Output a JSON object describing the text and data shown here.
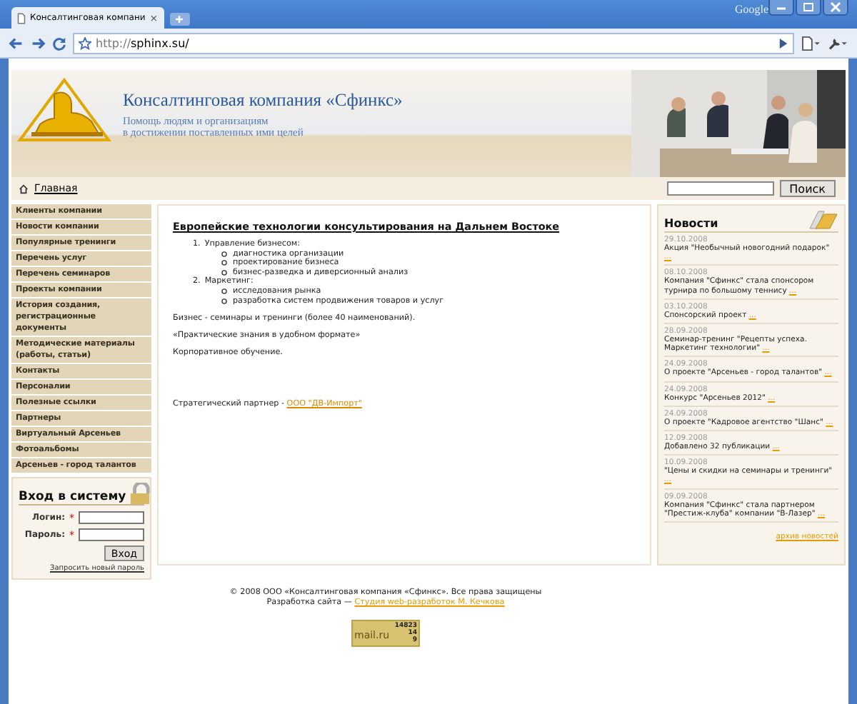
{
  "browser": {
    "brand": "Google",
    "tab_title": "Консалтинговая компани",
    "tab_close": "×",
    "url_prefix": "http://",
    "url_rest": "sphinx.su/"
  },
  "header": {
    "title": "Консалтинговая компания «Сфинкс»",
    "slogan": [
      "Помощь людям и организациям",
      "в достижении поставленных ими целей"
    ]
  },
  "breadcrumb": "Главная",
  "search": {
    "button": "Поиск"
  },
  "nav": [
    "Клиенты компании",
    "Новости компании",
    "Популярные тренинги",
    "Перечень услуг",
    "Перечень семинаров",
    "Проекты компании",
    "История создания, регистрационные документы",
    "Методические материалы (работы, статьи)",
    "Контакты",
    "Персоналии",
    "Полезные ссылки",
    "Партнеры",
    "Виртуальный Арсеньев",
    "Фотоальбомы",
    "Арсеньев - город талантов"
  ],
  "login": {
    "title": "Вход в систему",
    "fields": [
      {
        "label": "Логин:",
        "mark": "*"
      },
      {
        "label": "Пароль:",
        "mark": "*"
      }
    ],
    "button": "Вход",
    "link": "Запросить новый пароль"
  },
  "article": {
    "title": "Европейские технологии консультирования на Дальнем Востоке",
    "list": [
      {
        "number": "1.",
        "text": "Управление бизнесом:",
        "children": [
          "диагностика организации",
          "проектирование бизнеса",
          "бизнес-разведка и диверсионный анализ"
        ]
      },
      {
        "number": "2.",
        "text": "Маркетинг:",
        "children": [
          "исследования рынка",
          "разработка систем продвижения товаров и услуг"
        ]
      }
    ],
    "paragraphs": [
      "Бизнес - семинары и тренинги (более 40 наименований).",
      "«Практические знания в удобном формате»",
      "Корпоративное обучение."
    ],
    "partner": {
      "text": "Стратегический партнер - ",
      "link": "ООО \"ДВ-Импорт\""
    }
  },
  "news": {
    "title": "Новости",
    "items": [
      {
        "date": "29.10.2008",
        "text": "Акция \"Необычный новогодний подарок\" ",
        "more": "..."
      },
      {
        "date": "08.10.2008",
        "text": "Компания \"Сфинкс\" стала спонсором турнира по большому теннису ",
        "more": "..."
      },
      {
        "date": "03.10.2008",
        "text": "Спонсорский проект ",
        "more": "..."
      },
      {
        "date": "28.09.2008",
        "text": "Семинар-тренинг \"Рецепты успеха. Маркетинг технологии\" ",
        "more": "..."
      },
      {
        "date": "24.09.2008",
        "text": "О проекте \"Арсеньев - город талантов\" ",
        "more": "..."
      },
      {
        "date": "24.09.2008",
        "text": "Конкурс \"Арсеньев 2012\" ",
        "more": "..."
      },
      {
        "date": "24.09.2008",
        "text": "О проекте \"Кадровое агентство \"Шанс\" ",
        "more": "..."
      },
      {
        "date": "12.09.2008",
        "text": "Добавлено 32 публикации ",
        "more": "..."
      },
      {
        "date": "10.09.2008",
        "text": "\"Цены и скидки на семинары и тренинги\" ",
        "more": "..."
      },
      {
        "date": "09.09.2008",
        "text": "Компания \"Сфинкс\" стала партнером \"Престиж-клуба\" компании \"В-Лазер\" ",
        "more": "..."
      }
    ],
    "archive": "архив новостей"
  },
  "footer": {
    "copyright": "© 2008 ООО «Консалтинговая компания «Сфинкс». Все права защищены",
    "dev_text": "Разработка сайта — ",
    "dev_link": "Студия web-разработок М. Кечкова"
  },
  "counter": {
    "name": "mail.ru",
    "total": "14823",
    "today": "14",
    "online": "9"
  }
}
